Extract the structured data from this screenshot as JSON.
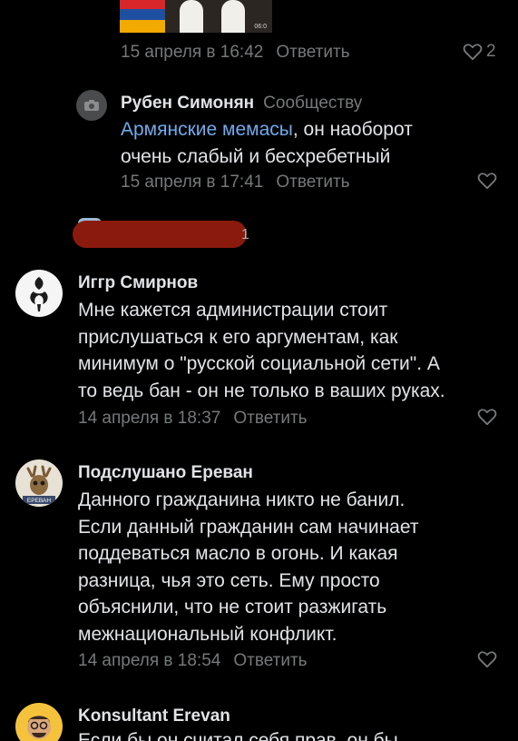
{
  "top_comment": {
    "image_stamp": "06:0",
    "date": "15 апреля в 16:42",
    "reply_label": "Ответить",
    "likes": "2"
  },
  "reply_ruben": {
    "author": "Рубен Симонян",
    "to_label": "Сообществу",
    "mention": "Армянские мемасы",
    "text_after_mention": ", он наоборот",
    "text_line2": "очень слабый и бесхребетный",
    "date": "15 апреля в 17:41",
    "reply_label": "Ответить"
  },
  "redacted_suffix": "1",
  "comments": [
    {
      "author": "Иггр Смирнов",
      "lines": [
        "Мне кажется администрации стоит",
        "прислушаться к его аргументам, как",
        "минимум о \"русской социальной сети\". А",
        "то ведь бан - он не только в ваших руках."
      ],
      "date": "14 апреля в 18:37",
      "reply_label": "Ответить"
    },
    {
      "author": "Подслушано Ереван",
      "avatar_caption": "ЕРЕВАН",
      "lines": [
        "Данного гражданина никто не банил.",
        "Если данный гражданин сам начинает",
        "поддеваться масло в огонь. И какая",
        "разница, чья это сеть. Ему просто",
        "объяснили, что не стоит разжигать",
        "межнациональный конфликт."
      ],
      "date": "14 апреля в 18:54",
      "reply_label": "Ответить"
    },
    {
      "author": "Konsultant Erevan",
      "lines": [
        "Если бы он считал себя прав, он бы"
      ]
    }
  ],
  "colors": {
    "background": "#000000",
    "text": "#e1e3e6",
    "secondary": "#76787a",
    "link": "#71aaeb"
  }
}
